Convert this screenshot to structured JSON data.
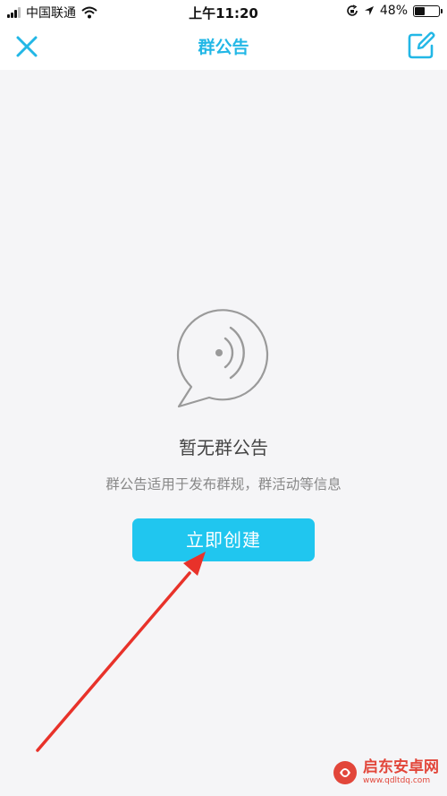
{
  "status_bar": {
    "carrier": "中国联通",
    "time": "上午11:20",
    "battery_percent": "48%",
    "battery_level": 0.48,
    "icons": [
      "signal-icon",
      "wifi-icon",
      "lock-rotation-icon",
      "location-arrow-icon",
      "battery-icon"
    ]
  },
  "nav": {
    "title": "群公告",
    "left_icon": "close-icon",
    "right_icon": "edit-icon"
  },
  "empty_state": {
    "icon": "announcement-bubble-icon",
    "title": "暂无群公告",
    "description": "群公告适用于发布群规，群活动等信息",
    "button_label": "立即创建"
  },
  "watermark": {
    "name": "启东安卓网",
    "url": "www.qdltdq.com"
  },
  "colors": {
    "accent": "#22b7e6",
    "button": "#20c6ef",
    "background": "#f5f5f7",
    "arrow": "#e8322a"
  }
}
